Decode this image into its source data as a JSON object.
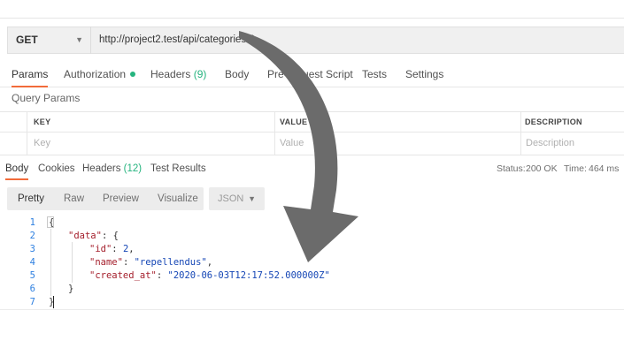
{
  "request": {
    "method": "GET",
    "url": "http://project2.test/api/categories/2"
  },
  "request_tabs": [
    {
      "label": "Params",
      "active": true
    },
    {
      "label": "Authorization",
      "dot": true
    },
    {
      "label": "Headers",
      "count": "(9)"
    },
    {
      "label": "Body"
    },
    {
      "label": "Pre-request Script"
    },
    {
      "label": "Tests"
    },
    {
      "label": "Settings"
    }
  ],
  "query_params": {
    "title": "Query Params",
    "columns": [
      "KEY",
      "VALUE",
      "DESCRIPTION"
    ],
    "placeholders": [
      "Key",
      "Value",
      "Description"
    ]
  },
  "response_tabs": [
    {
      "label": "Body",
      "active": true
    },
    {
      "label": "Cookies"
    },
    {
      "label": "Headers",
      "count": "(12)"
    },
    {
      "label": "Test Results"
    }
  ],
  "response_status": {
    "status_label": "Status:",
    "status_value": "200 OK",
    "time_label": "Time:",
    "time_value": "464 ms"
  },
  "view_modes": [
    "Pretty",
    "Raw",
    "Preview",
    "Visualize"
  ],
  "format": "JSON",
  "code_lines": [
    "1",
    "2",
    "3",
    "4",
    "5",
    "6",
    "7"
  ],
  "json_body": {
    "data_key": "\"data\"",
    "id_key": "\"id\"",
    "id_value": "2",
    "name_key": "\"name\"",
    "name_value": "\"repellendus\"",
    "created_key": "\"created_at\"",
    "created_value": "\"2020-06-03T12:17:52.000000Z\""
  },
  "colors": {
    "accent": "#f26b3a",
    "success": "#26b47f",
    "json_key": "#a5202d",
    "json_value": "#1546b5",
    "arrow": "#6b6b6b"
  },
  "icons": [
    "chevron-down-icon",
    "curved-arrow-annotation"
  ]
}
